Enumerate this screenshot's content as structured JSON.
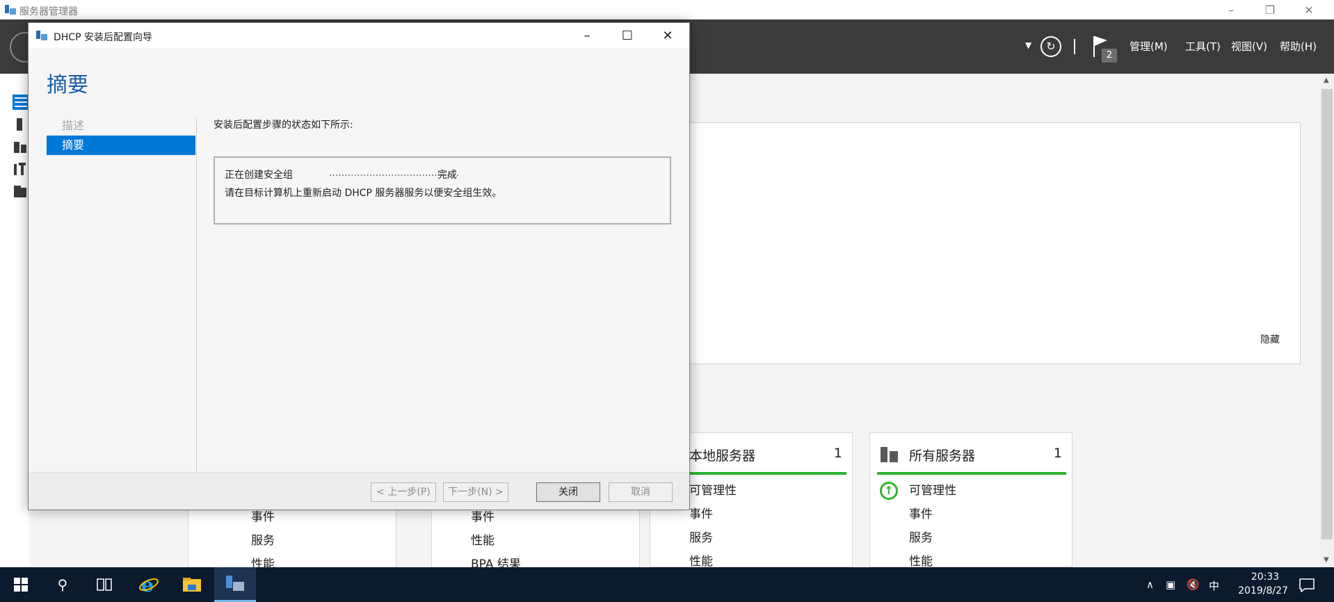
{
  "server_manager": {
    "title": "服务器管理器",
    "menu": {
      "manage": "管理(M)",
      "tools": "工具(T)",
      "view": "视图(V)",
      "help": "帮助(H)"
    },
    "notification_count": "2",
    "hide_label": "隐藏"
  },
  "tiles": [
    {
      "title": "本地服务器",
      "count": "1",
      "rows": [
        "可管理性",
        "事件",
        "服务",
        "性能"
      ]
    },
    {
      "title": "所有服务器",
      "count": "1",
      "rows": [
        "可管理性",
        "事件",
        "服务",
        "性能"
      ]
    }
  ],
  "bg_tiles": [
    {
      "rows": [
        "事件",
        "服务",
        "性能"
      ]
    },
    {
      "rows": [
        "事件",
        "性能",
        "BPA 结果"
      ]
    }
  ],
  "wizard": {
    "title": "DHCP 安装后配置向导",
    "heading": "摘要",
    "steps": [
      {
        "label": "描述",
        "active": false
      },
      {
        "label": "摘要",
        "active": true
      }
    ],
    "description": "安装后配置步骤的状态如下所示:",
    "status_line": {
      "task": "正在创建安全组",
      "dots": "..........................................",
      "result": "完成"
    },
    "status_message": "请在目标计算机上重新启动 DHCP 服务器服务以便安全组生效。",
    "buttons": {
      "prev": "< 上一步(P)",
      "next": "下一步(N) >",
      "close": "关闭",
      "cancel": "取消"
    }
  },
  "taskbar": {
    "time": "20:33",
    "date": "2019/8/27",
    "ime": "中"
  },
  "colors": {
    "accent": "#0078d7",
    "header": "#3b3b3b",
    "ok_green": "#2fb42f",
    "taskbar": "#0b1a2d"
  }
}
